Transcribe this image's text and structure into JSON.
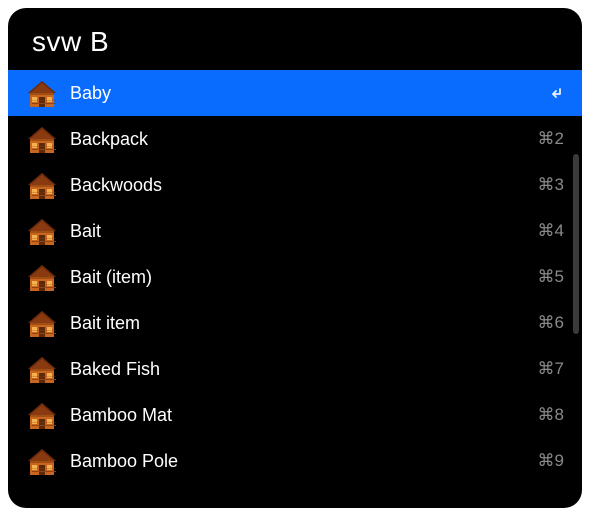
{
  "search": {
    "value": "svw B"
  },
  "results": [
    {
      "label": "Baby",
      "shortcut": "",
      "selected": true,
      "enter": true
    },
    {
      "label": "Backpack",
      "shortcut": "⌘2",
      "selected": false,
      "enter": false
    },
    {
      "label": "Backwoods",
      "shortcut": "⌘3",
      "selected": false,
      "enter": false
    },
    {
      "label": "Bait",
      "shortcut": "⌘4",
      "selected": false,
      "enter": false
    },
    {
      "label": "Bait (item)",
      "shortcut": "⌘5",
      "selected": false,
      "enter": false
    },
    {
      "label": "Bait item",
      "shortcut": "⌘6",
      "selected": false,
      "enter": false
    },
    {
      "label": "Baked Fish",
      "shortcut": "⌘7",
      "selected": false,
      "enter": false
    },
    {
      "label": "Bamboo Mat",
      "shortcut": "⌘8",
      "selected": false,
      "enter": false
    },
    {
      "label": "Bamboo Pole",
      "shortcut": "⌘9",
      "selected": false,
      "enter": false
    }
  ],
  "icons": {
    "item": "house-icon"
  }
}
